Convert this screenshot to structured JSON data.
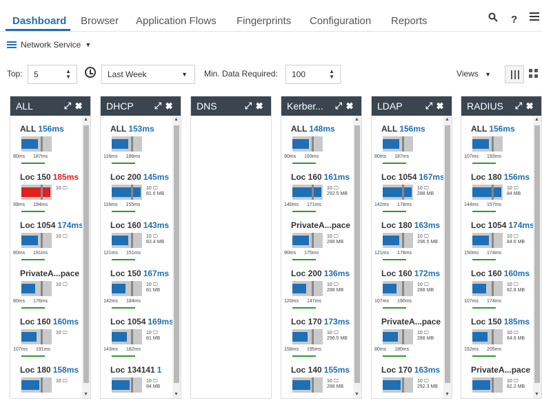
{
  "nav": {
    "tabs": [
      {
        "label": "Dashboard",
        "active": true
      },
      {
        "label": "Browser"
      },
      {
        "label": "Application Flows"
      },
      {
        "label": "Fingerprints"
      },
      {
        "label": "Configuration"
      },
      {
        "label": "Reports"
      }
    ],
    "icons": {
      "search": "search-icon",
      "help": "?",
      "menu": "hamburger-menu-icon"
    }
  },
  "service": {
    "label": "Network Service"
  },
  "filters": {
    "top_label": "Top:",
    "top_value": "5",
    "period": "Last Week",
    "min_data_label": "Min. Data Required:",
    "min_data_value": "100",
    "views_label": "Views"
  },
  "colors": {
    "accent": "#1f6fb5",
    "header": "#3a4550",
    "alert": "#e02020",
    "good": "#2c9a2c"
  },
  "columns": [
    {
      "title": "ALL",
      "cards": [
        {
          "name": "ALL",
          "ms": "156ms",
          "meta1": "",
          "meta2": "",
          "lo": "80ms",
          "hi": "187ms"
        },
        {
          "name": "Loc 150",
          "ms": "185ms",
          "red": true,
          "meta1": "10",
          "meta2": "",
          "lo": "99ms",
          "hi": "194ms"
        },
        {
          "name": "Loc 1054",
          "ms": "174ms",
          "meta1": "10",
          "meta2": "",
          "lo": "80ms",
          "hi": "191ms"
        },
        {
          "name": "PrivateA...pace",
          "ms": "",
          "meta1": "10",
          "meta2": "",
          "lo": "80ms",
          "hi": "176ms"
        },
        {
          "name": "Loc 160",
          "ms": "160ms",
          "meta1": "10",
          "meta2": "",
          "lo": "107ms",
          "hi": "191ms"
        },
        {
          "name": "Loc 180",
          "ms": "158ms",
          "meta1": "10",
          "meta2": "",
          "lo": "",
          "hi": ""
        }
      ]
    },
    {
      "title": "DHCP",
      "cards": [
        {
          "name": "ALL",
          "ms": "153ms",
          "meta1": "",
          "meta2": "",
          "lo": "116ms",
          "hi": "186ms"
        },
        {
          "name": "Loc 200",
          "ms": "145ms",
          "meta1": "10",
          "meta2": "81.6 MB",
          "lo": "116ms",
          "hi": "155ms"
        },
        {
          "name": "Loc 160",
          "ms": "143ms",
          "meta1": "10",
          "meta2": "83.4 MB",
          "lo": "121ms",
          "hi": "151ms"
        },
        {
          "name": "Loc 150",
          "ms": "167ms",
          "meta1": "10",
          "meta2": "81 MB",
          "lo": "142ms",
          "hi": "184ms"
        },
        {
          "name": "Loc 1054",
          "ms": "169ms",
          "meta1": "10",
          "meta2": "81 MB",
          "lo": "143ms",
          "hi": "182ms"
        },
        {
          "name": "Loc 134141",
          "ms": "1",
          "meta1": "10",
          "meta2": "84 MB",
          "lo": "",
          "hi": ""
        }
      ]
    },
    {
      "title": "DNS",
      "cards": []
    },
    {
      "title": "Kerber...",
      "cards": [
        {
          "name": "ALL",
          "ms": "148ms",
          "meta1": "",
          "meta2": "",
          "lo": "90ms",
          "hi": "193ms"
        },
        {
          "name": "Loc 160",
          "ms": "161ms",
          "meta1": "10",
          "meta2": "292.5 MB",
          "lo": "140ms",
          "hi": "171ms"
        },
        {
          "name": "PrivateA...pace",
          "ms": "",
          "meta1": "10",
          "meta2": "288 MB",
          "lo": "90ms",
          "hi": "175ms"
        },
        {
          "name": "Loc 200",
          "ms": "136ms",
          "meta1": "10",
          "meta2": "288 MB",
          "lo": "120ms",
          "hi": "147ms"
        },
        {
          "name": "Loc 170",
          "ms": "173ms",
          "meta1": "10",
          "meta2": "296.5 MB",
          "lo": "158ms",
          "hi": "195ms"
        },
        {
          "name": "Loc 140",
          "ms": "155ms",
          "meta1": "10",
          "meta2": "288 MB",
          "lo": "",
          "hi": ""
        }
      ]
    },
    {
      "title": "LDAP",
      "cards": [
        {
          "name": "ALL",
          "ms": "156ms",
          "meta1": "",
          "meta2": "",
          "lo": "80ms",
          "hi": "187ms"
        },
        {
          "name": "Loc 1054",
          "ms": "167ms",
          "meta1": "10",
          "meta2": "288 MB",
          "lo": "142ms",
          "hi": "178ms"
        },
        {
          "name": "Loc 180",
          "ms": "163ms",
          "meta1": "10",
          "meta2": "296.5 MB",
          "lo": "121ms",
          "hi": "178ms"
        },
        {
          "name": "Loc 160",
          "ms": "172ms",
          "meta1": "10",
          "meta2": "288 MB",
          "lo": "107ms",
          "hi": "190ms"
        },
        {
          "name": "PrivateA...pace",
          "ms": "",
          "meta1": "10",
          "meta2": "288 MB",
          "lo": "80ms",
          "hi": "180ms"
        },
        {
          "name": "Loc 170",
          "ms": "163ms",
          "meta1": "10",
          "meta2": "292.3 MB",
          "lo": "",
          "hi": ""
        }
      ]
    },
    {
      "title": "RADIUS",
      "cards": [
        {
          "name": "ALL",
          "ms": "156ms",
          "meta1": "",
          "meta2": "",
          "lo": "107ms",
          "hi": "193ms"
        },
        {
          "name": "Loc 180",
          "ms": "156ms",
          "meta1": "10",
          "meta2": "84 MB",
          "lo": "144ms",
          "hi": "157ms"
        },
        {
          "name": "Loc 1054",
          "ms": "174ms",
          "meta1": "10",
          "meta2": "84.6 MB",
          "lo": "150ms",
          "hi": "174ms"
        },
        {
          "name": "Loc 160",
          "ms": "160ms",
          "meta1": "10",
          "meta2": "82.8 MB",
          "lo": "107ms",
          "hi": "174ms"
        },
        {
          "name": "Loc 150",
          "ms": "185ms",
          "meta1": "10",
          "meta2": "84.6 MB",
          "lo": "152ms",
          "hi": "205ms"
        },
        {
          "name": "PrivateA...pace",
          "ms": "",
          "meta1": "10",
          "meta2": "82.2 MB",
          "lo": "",
          "hi": ""
        }
      ]
    }
  ]
}
